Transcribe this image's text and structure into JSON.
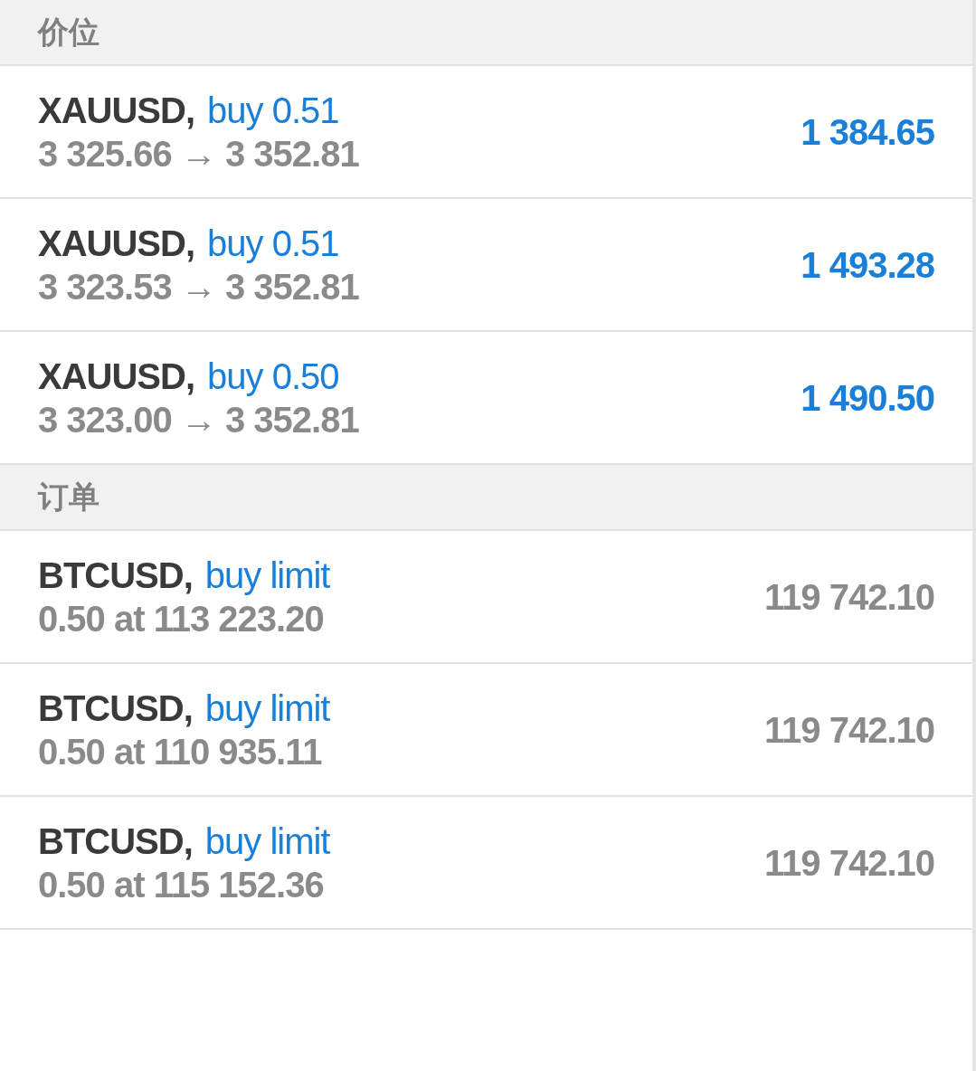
{
  "sections": [
    {
      "kind": "positions",
      "title": "价位",
      "rows": [
        {
          "symbol": "XAUUSD,",
          "type": "buy 0.51",
          "detail": "3 325.66 → 3 352.81",
          "value": "1 384.65"
        },
        {
          "symbol": "XAUUSD,",
          "type": "buy 0.51",
          "detail": "3 323.53 → 3 352.81",
          "value": "1 493.28"
        },
        {
          "symbol": "XAUUSD,",
          "type": "buy 0.50",
          "detail": "3 323.00 → 3 352.81",
          "value": "1 490.50"
        }
      ]
    },
    {
      "kind": "orders",
      "title": "订单",
      "rows": [
        {
          "symbol": "BTCUSD,",
          "type": "buy limit",
          "detail": "0.50 at 113 223.20",
          "value": "119 742.10"
        },
        {
          "symbol": "BTCUSD,",
          "type": "buy limit",
          "detail": "0.50 at 110 935.11",
          "value": "119 742.10"
        },
        {
          "symbol": "BTCUSD,",
          "type": "buy limit",
          "detail": "0.50 at 115 152.36",
          "value": "119 742.10"
        }
      ]
    }
  ]
}
